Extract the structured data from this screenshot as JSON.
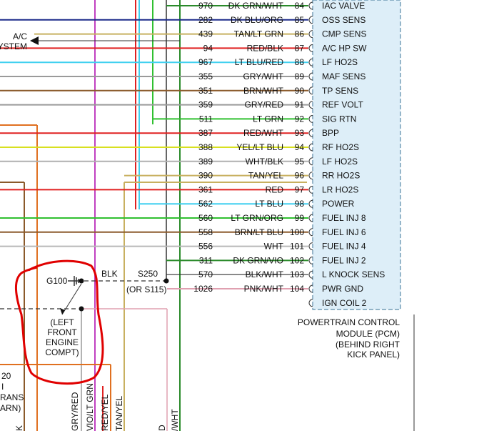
{
  "left_labels": {
    "ac_line1": "A/C",
    "ac_line2": "YSTEM"
  },
  "wires": [
    {
      "circuit": "970",
      "color_name": "DK GRN/WHT",
      "pin": "84",
      "signal": "IAC VALVE",
      "line_hex": "#2a8a2a"
    },
    {
      "circuit": "282",
      "color_name": "DK BLU/ORG",
      "pin": "85",
      "signal": "OSS SENS",
      "line_hex": "#1c2a8a"
    },
    {
      "circuit": "439",
      "color_name": "TAN/LT GRN",
      "pin": "86",
      "signal": "CMP SENS",
      "line_hex": "#c8b060"
    },
    {
      "circuit": "94",
      "color_name": "RED/BLK",
      "pin": "87",
      "signal": "A/C HP SW",
      "line_hex": "#e02020"
    },
    {
      "circuit": "967",
      "color_name": "LT BLU/RED",
      "pin": "88",
      "signal": "LF HO2S",
      "line_hex": "#40d0f0"
    },
    {
      "circuit": "355",
      "color_name": "GRY/WHT",
      "pin": "89",
      "signal": "MAF SENS",
      "line_hex": "#9a9a9a"
    },
    {
      "circuit": "351",
      "color_name": "BRN/WHT",
      "pin": "90",
      "signal": "TP SENS",
      "line_hex": "#8b5a2b"
    },
    {
      "circuit": "359",
      "color_name": "GRY/RED",
      "pin": "91",
      "signal": "REF VOLT",
      "line_hex": "#9a9a9a"
    },
    {
      "circuit": "511",
      "color_name": "LT GRN",
      "pin": "92",
      "signal": "SIG RTN",
      "line_hex": "#30c030"
    },
    {
      "circuit": "387",
      "color_name": "RED/WHT",
      "pin": "93",
      "signal": "BPP",
      "line_hex": "#e02020"
    },
    {
      "circuit": "388",
      "color_name": "YEL/LT BLU",
      "pin": "94",
      "signal": "RF HO2S",
      "line_hex": "#d8e020"
    },
    {
      "circuit": "389",
      "color_name": "WHT/BLK",
      "pin": "95",
      "signal": "LF HO2S",
      "line_hex": "#b0b0b0"
    },
    {
      "circuit": "390",
      "color_name": "TAN/YEL",
      "pin": "96",
      "signal": "RR HO2S",
      "line_hex": "#c8b060"
    },
    {
      "circuit": "361",
      "color_name": "RED",
      "pin": "97",
      "signal": "LR HO2S",
      "line_hex": "#e02020"
    },
    {
      "circuit": "562",
      "color_name": "LT BLU",
      "pin": "98",
      "signal": "POWER",
      "line_hex": "#40d0f0"
    },
    {
      "circuit": "560",
      "color_name": "LT GRN/ORG",
      "pin": "99",
      "signal": "FUEL INJ 8",
      "line_hex": "#30c030"
    },
    {
      "circuit": "558",
      "color_name": "BRN/LT BLU",
      "pin": "100",
      "signal": "FUEL INJ 6",
      "line_hex": "#8b5a2b"
    },
    {
      "circuit": "556",
      "color_name": "WHT",
      "pin": "101",
      "signal": "FUEL INJ 4",
      "line_hex": "#b8b8b8"
    },
    {
      "circuit": "311",
      "color_name": "DK GRN/VIO",
      "pin": "102",
      "signal": "FUEL INJ 2",
      "line_hex": "#2a8a2a"
    },
    {
      "circuit": "570",
      "color_name": "BLK/WHT",
      "pin": "103",
      "signal": "L KNOCK SENS",
      "line_hex": "#333333"
    },
    {
      "circuit": "1026",
      "color_name": "PNK/WHT",
      "pin": "104",
      "signal": "PWR GND",
      "line_hex": "#e0a0b0"
    },
    {
      "circuit": "",
      "color_name": "",
      "pin": "",
      "signal": "IGN COIL 2",
      "line_hex": "#ffffff"
    }
  ],
  "ground": {
    "g100": "G100",
    "blk": "BLK",
    "s250": "S250",
    "or_s115": "(OR S115)",
    "note_line1": "(LEFT",
    "note_line2": "FRONT",
    "note_line3": "ENGINE",
    "note_line4": "COMPT)"
  },
  "pcm": {
    "line1": "POWERTRAIN CONTROL",
    "line2": "MODULE (PCM)",
    "line3": "(BEHIND RIGHT",
    "line4": "KICK PANEL)"
  },
  "bottom_left": {
    "line1": "20",
    "line2": "I",
    "line3": "RANS",
    "line4": "ARN)"
  },
  "vertical_labels": {
    "v1": "K",
    "v2": "GRY/RED",
    "v3": "VIO/LT GRN",
    "v4": "RED/YEL",
    "v5": "TAN/YEL",
    "v6": "D",
    "v7": "/WHT"
  },
  "colors": {
    "annotation_red": "#e00000",
    "pcm_box_fill": "#ddeef8",
    "pcm_box_stroke": "#5a8aa8"
  }
}
